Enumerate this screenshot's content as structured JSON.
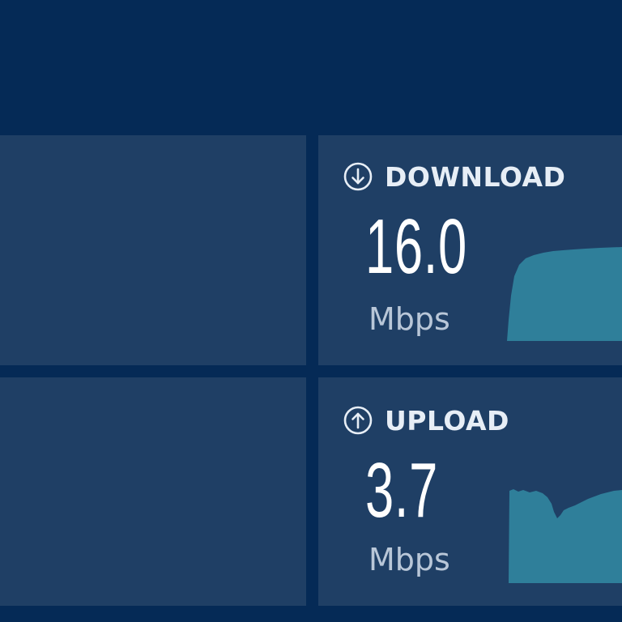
{
  "colors": {
    "background": "#052a56",
    "panel": "#1f3f65",
    "graph_fill": "#2f7f9a",
    "text_primary": "#ffffff",
    "text_secondary": "#b9c7d8"
  },
  "download": {
    "icon": "arrow-down-circle-icon",
    "label": "DOWNLOAD",
    "value": "16.0",
    "unit": "Mbps"
  },
  "upload": {
    "icon": "arrow-up-circle-icon",
    "label": "UPLOAD",
    "value": "3.7",
    "unit": "Mbps"
  }
}
